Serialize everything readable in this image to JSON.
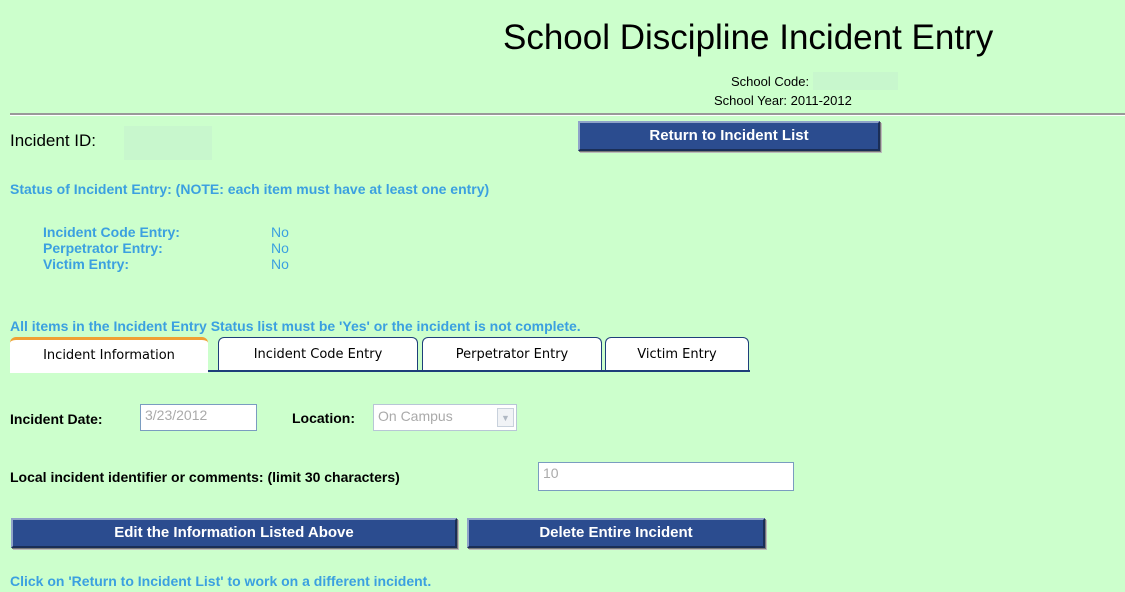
{
  "header": {
    "title": "School Discipline Incident Entry",
    "school_code_label": "School Code:",
    "school_year": "School Year: 2011-2012"
  },
  "incident": {
    "id_label": "Incident ID:",
    "return_button": "Return to Incident List"
  },
  "status": {
    "heading": "Status of Incident Entry: (NOTE: each item must have at least one entry)",
    "items": [
      {
        "label": "Incident Code Entry:",
        "value": "No"
      },
      {
        "label": "Perpetrator Entry:",
        "value": "No"
      },
      {
        "label": "Victim Entry:",
        "value": "No"
      }
    ],
    "note": "All items in the Incident Entry Status list must be 'Yes' or the incident is not complete."
  },
  "tabs": [
    {
      "label": "Incident Information",
      "active": true
    },
    {
      "label": "Incident Code Entry",
      "active": false
    },
    {
      "label": "Perpetrator Entry",
      "active": false
    },
    {
      "label": "Victim Entry",
      "active": false
    }
  ],
  "form": {
    "date_label": "Incident Date:",
    "date_value": "3/23/2012",
    "location_label": "Location:",
    "location_value": "On Campus",
    "comments_label": "Local incident identifier or comments: (limit 30 characters)",
    "comments_value": "10"
  },
  "actions": {
    "edit_button": "Edit the Information Listed Above",
    "delete_button": "Delete Entire Incident"
  },
  "footer": {
    "text": "Click on 'Return to Incident List' to work on a different incident."
  },
  "colors": {
    "background": "#ccffcc",
    "button": "#2b4c8f",
    "status_text": "#3ba0e0",
    "active_tab_accent": "#f0a033"
  }
}
